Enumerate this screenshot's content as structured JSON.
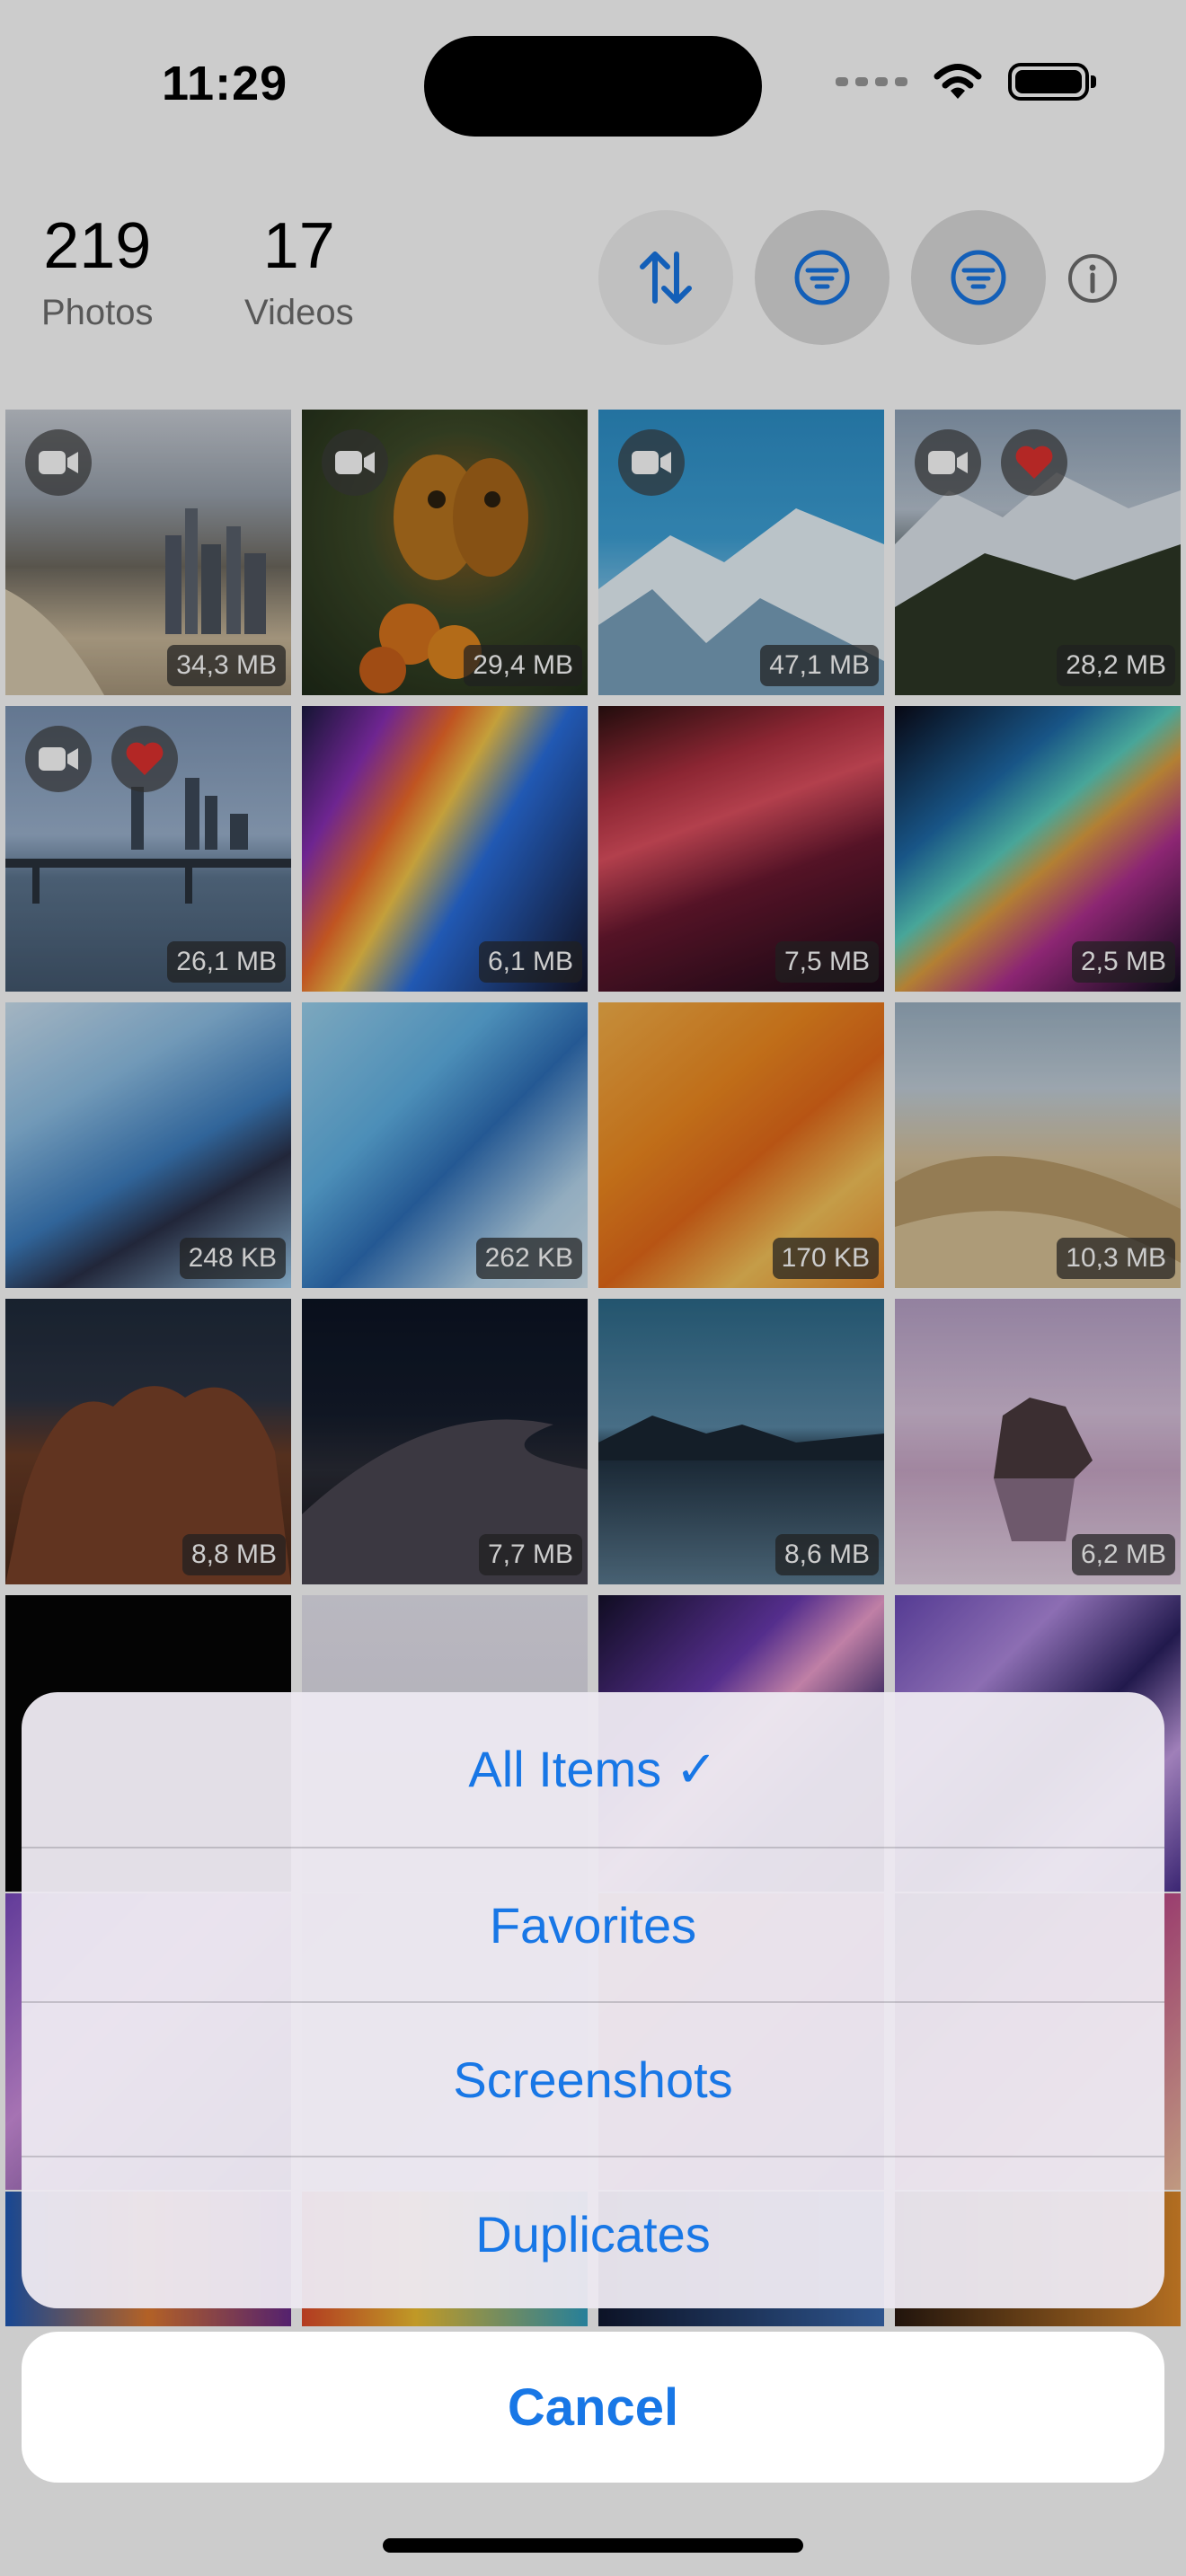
{
  "status_bar": {
    "time": "11:29"
  },
  "header": {
    "photos_count": "219",
    "photos_label": "Photos",
    "videos_count": "17",
    "videos_label": "Videos"
  },
  "colors": {
    "accent": "#1877e6",
    "favorite": "#e0312f"
  },
  "grid": {
    "tiles": [
      {
        "size": "34,3 MB",
        "video": true,
        "favorite": false
      },
      {
        "size": "29,4 MB",
        "video": true,
        "favorite": false
      },
      {
        "size": "47,1 MB",
        "video": true,
        "favorite": false
      },
      {
        "size": "28,2 MB",
        "video": true,
        "favorite": true
      },
      {
        "size": "26,1 MB",
        "video": true,
        "favorite": true
      },
      {
        "size": "6,1 MB",
        "video": false,
        "favorite": false
      },
      {
        "size": "7,5 MB",
        "video": false,
        "favorite": false
      },
      {
        "size": "2,5 MB",
        "video": false,
        "favorite": false
      },
      {
        "size": "248 KB",
        "video": false,
        "favorite": false
      },
      {
        "size": "262 KB",
        "video": false,
        "favorite": false
      },
      {
        "size": "170 KB",
        "video": false,
        "favorite": false
      },
      {
        "size": "10,3 MB",
        "video": false,
        "favorite": false
      },
      {
        "size": "8,8 MB",
        "video": false,
        "favorite": false
      },
      {
        "size": "7,7 MB",
        "video": false,
        "favorite": false
      },
      {
        "size": "8,6 MB",
        "video": false,
        "favorite": false
      },
      {
        "size": "6,2 MB",
        "video": false,
        "favorite": false
      }
    ]
  },
  "action_sheet": {
    "items": [
      {
        "label": "All Items ✓"
      },
      {
        "label": "Favorites"
      },
      {
        "label": "Screenshots"
      },
      {
        "label": "Duplicates"
      }
    ],
    "cancel_label": "Cancel"
  },
  "icons": {
    "sort": "arrow-up-down-icon",
    "filter": "filter-lines-icon",
    "info": "info-circle-icon",
    "video": "video-camera-icon",
    "favorite": "heart-icon",
    "wifi": "wifi-icon",
    "battery": "battery-icon"
  }
}
